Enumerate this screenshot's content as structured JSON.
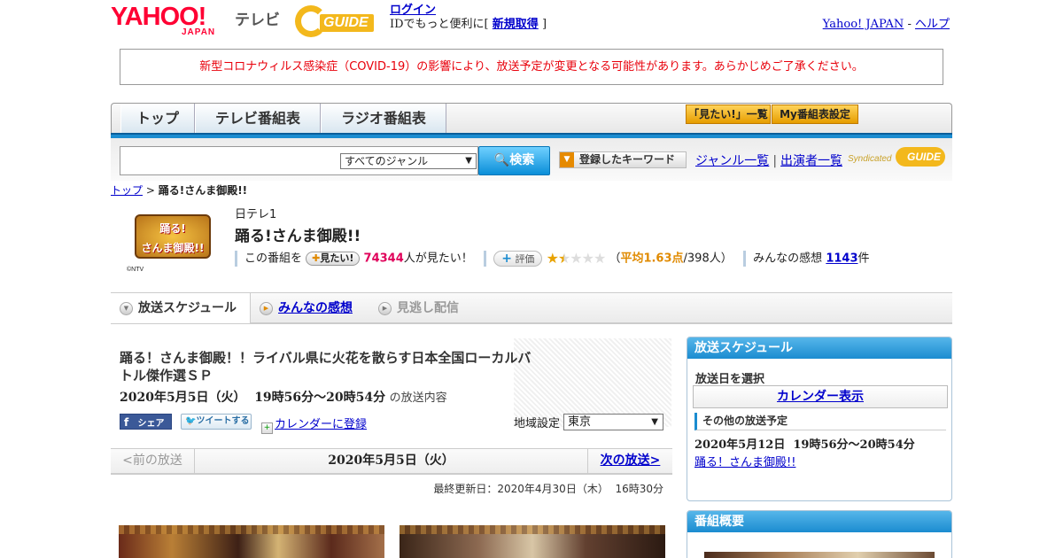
{
  "header": {
    "yahoo_logo": "YAHOO!",
    "yahoo_sub": "JAPAN",
    "tv_label": "テレビ",
    "gguide_logo": "GUIDE",
    "login_link": "ログイン",
    "login_text": "IDでもっと便利に[",
    "signup_link": "新規取得",
    "login_text_end": "]",
    "yahoo_japan_link": "Yahoo! JAPAN",
    "sep": "-",
    "help_link": "ヘルプ"
  },
  "notice": "新型コロナウィルス感染症（COVID-19）の影響により、放送予定が変更となる可能性があります。あらかじめご了承ください。",
  "mainnav": {
    "tabs": [
      "トップ",
      "テレビ番組表",
      "ラジオ番組表"
    ],
    "want_list": "「見たい!」一覧",
    "my_settings": "My番組表設定"
  },
  "search": {
    "input_value": "",
    "genre_selected": "すべてのジャンル",
    "search_button": "検索",
    "keyword_button": "登録したキーワード",
    "genre_list_link": "ジャンル一覧",
    "link_sep": "|",
    "cast_list_link": "出演者一覧",
    "syndicated": "Syndicated",
    "syndicated_logo": "GUIDE"
  },
  "breadcrumb": {
    "top": "トップ",
    "sep": ">",
    "current": "踊る!さんま御殿!!"
  },
  "program": {
    "thumb_text_line1": "踊る!",
    "thumb_text_line2": "さんま御殿!!",
    "thumb_credit": "©NTV",
    "station": "日テレ1",
    "title": "踊る!さんま御殿!!",
    "want_prefix": "この番組を",
    "want_badge": "見たい!",
    "want_count": "74344",
    "want_suffix": "人が見たい！",
    "eval_badge": "評価",
    "rating_stars": 1.63,
    "rating_text_open": "（",
    "rating_avg": "平均1.63点",
    "rating_people": "/398人",
    "rating_text_close": "）",
    "review_prefix": "みんなの感想",
    "review_count": "1143",
    "review_suffix": "件"
  },
  "subtabs": [
    "放送スケジュール",
    "みんなの感想",
    "見逃し配信"
  ],
  "broadcast": {
    "title": "踊る！さんま御殿！！ライバル県に火花を散らす日本全国ローカルバトル傑作選ＳＰ",
    "date": "2020年5月5日（火）  19時56分～20時54分",
    "date_suffix": "の放送内容",
    "share_fb": "シェア",
    "share_tw": "ツイートする",
    "calendar_link": "カレンダーに登録",
    "region_label": "地域設定",
    "region_value": "東京",
    "prev": "<前の放送",
    "current_date": "2020年5月5日（火）",
    "next": "次の放送>",
    "updated": "最終更新日：2020年4月30日（木）  16時30分"
  },
  "sidebar": {
    "schedule_head": "放送スケジュール",
    "choose_date": "放送日を選択",
    "calendar_button": "カレンダー表示",
    "other_head": "その他の放送予定",
    "other_date": "2020年5月12日  19時56分～20時54分",
    "other_link": "踊る！さんま御殿!!",
    "overview_head": "番組概要"
  },
  "colors": {
    "accent_blue": "#1b8cd0",
    "notice_red": "#e8000b",
    "want_pink": "#e0005a",
    "rating_orange": "#e08a00"
  }
}
